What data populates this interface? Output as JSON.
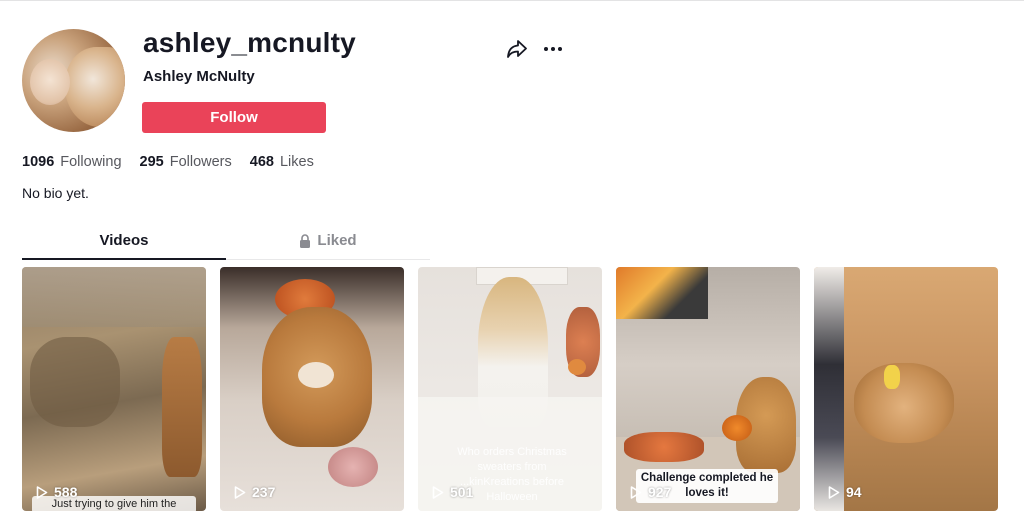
{
  "profile": {
    "username": "ashley_mcnulty",
    "display_name": "Ashley McNulty",
    "follow_label": "Follow",
    "bio": "No bio yet."
  },
  "stats": [
    {
      "value": "1096",
      "label": "Following"
    },
    {
      "value": "295",
      "label": "Followers"
    },
    {
      "value": "468",
      "label": "Likes"
    }
  ],
  "tabs": {
    "videos": "Videos",
    "liked": "Liked"
  },
  "videos": [
    {
      "plays": "588",
      "caption": "Just trying to give him the"
    },
    {
      "plays": "237",
      "caption": ""
    },
    {
      "plays": "501",
      "caption": "Who orders Christmas sweaters from ...kinKreations before Halloween"
    },
    {
      "plays": "927",
      "caption": "Challenge completed he loves it!"
    },
    {
      "plays": "94",
      "caption": ""
    }
  ],
  "icons": {
    "share": "share-icon",
    "more": "more-options-icon",
    "lock": "lock-icon",
    "play": "play-icon"
  },
  "colors": {
    "follow_button": "#ea4359",
    "text_primary": "#161823",
    "text_secondary": "#57585e"
  }
}
